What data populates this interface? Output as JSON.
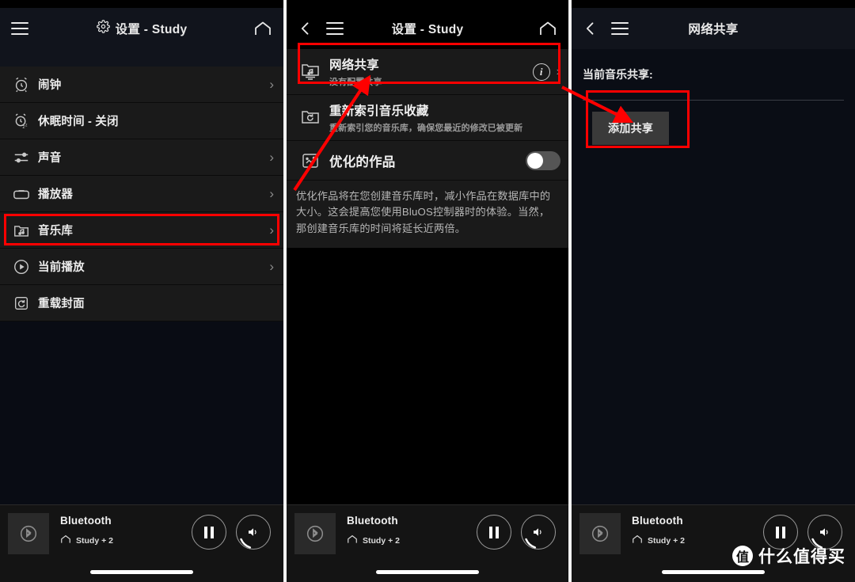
{
  "panel1": {
    "header": {
      "menu_icon": "hamburger-icon",
      "gear_icon": "gear-icon",
      "title": "设置 - Study",
      "home_icon": "home-icon"
    },
    "items": [
      {
        "icon": "alarm-clock-icon",
        "label": "闹钟",
        "chevron": "›"
      },
      {
        "icon": "sleep-timer-icon",
        "label": "休眠时间 - 关闭",
        "chevron": ""
      },
      {
        "icon": "equalizer-icon",
        "label": "声音",
        "chevron": "›"
      },
      {
        "icon": "player-icon",
        "label": "播放器",
        "chevron": "›"
      },
      {
        "icon": "music-folder-icon",
        "label": "音乐库",
        "chevron": "›"
      },
      {
        "icon": "play-circle-icon",
        "label": "当前播放",
        "chevron": "›"
      },
      {
        "icon": "reload-icon",
        "label": "重载封面",
        "chevron": ""
      }
    ]
  },
  "panel2": {
    "header": {
      "back_icon": "back-arrow-icon",
      "menu_icon": "hamburger-icon",
      "title": "设置 - Study",
      "home_icon": "home-icon"
    },
    "items": [
      {
        "icon": "network-share-icon",
        "title": "网络共享",
        "subtitle": "没有配置共享",
        "info_icon": "info-icon",
        "info_glyph": "i",
        "chevron": "›"
      },
      {
        "icon": "reindex-folder-icon",
        "title": "重新索引音乐收藏",
        "subtitle": "重新索引您的音乐库，确保您最近的修改已被更新",
        "chevron": ""
      }
    ],
    "toggle_row": {
      "icon": "optimize-artwork-icon",
      "title": "优化的作品",
      "toggle_state": "off"
    },
    "description": "优化作品将在您创建音乐库时，减小作品在数据库中的大小。这会提高您使用BluOS控制器时的体验。当然，那创建音乐库的时间将延长近两倍。"
  },
  "panel3": {
    "header": {
      "back_icon": "back-arrow-icon",
      "menu_icon": "hamburger-icon",
      "title": "网络共享"
    },
    "current_shares_label": "当前音乐共享:",
    "add_share_button": "添加共享"
  },
  "player": {
    "source_icon": "bluetooth-icon",
    "source": "Bluetooth",
    "zone_icon": "home-icon",
    "zone": "Study + 2",
    "pause_button": "pause-icon",
    "volume_button": "volume-icon"
  },
  "watermark": {
    "logo": "值",
    "text": "什么值得买"
  },
  "colors": {
    "annotation_red": "#ff0000",
    "header_bg": "#11141c",
    "row_bg": "#1a1a1a",
    "panel_bg": "#0a0d15",
    "accent_text": "#ededed"
  }
}
